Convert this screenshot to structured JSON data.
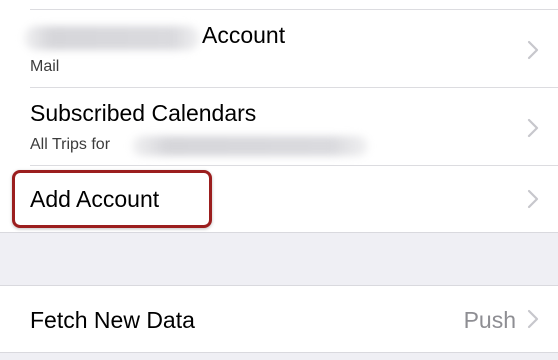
{
  "accounts_group": {
    "rows": [
      {
        "title_suffix": "Account",
        "subtitle": "Mail"
      },
      {
        "title": "Subscribed Calendars",
        "subtitle_prefix": "All Trips for"
      },
      {
        "title": "Add Account"
      }
    ]
  },
  "fetch_group": {
    "title": "Fetch New Data",
    "value": "Push"
  },
  "colors": {
    "highlight": "#9b1e1e",
    "chevron": "#c7c7cc",
    "background": "#efeff4"
  },
  "icons": {
    "chevron": "chevron-right-icon"
  }
}
